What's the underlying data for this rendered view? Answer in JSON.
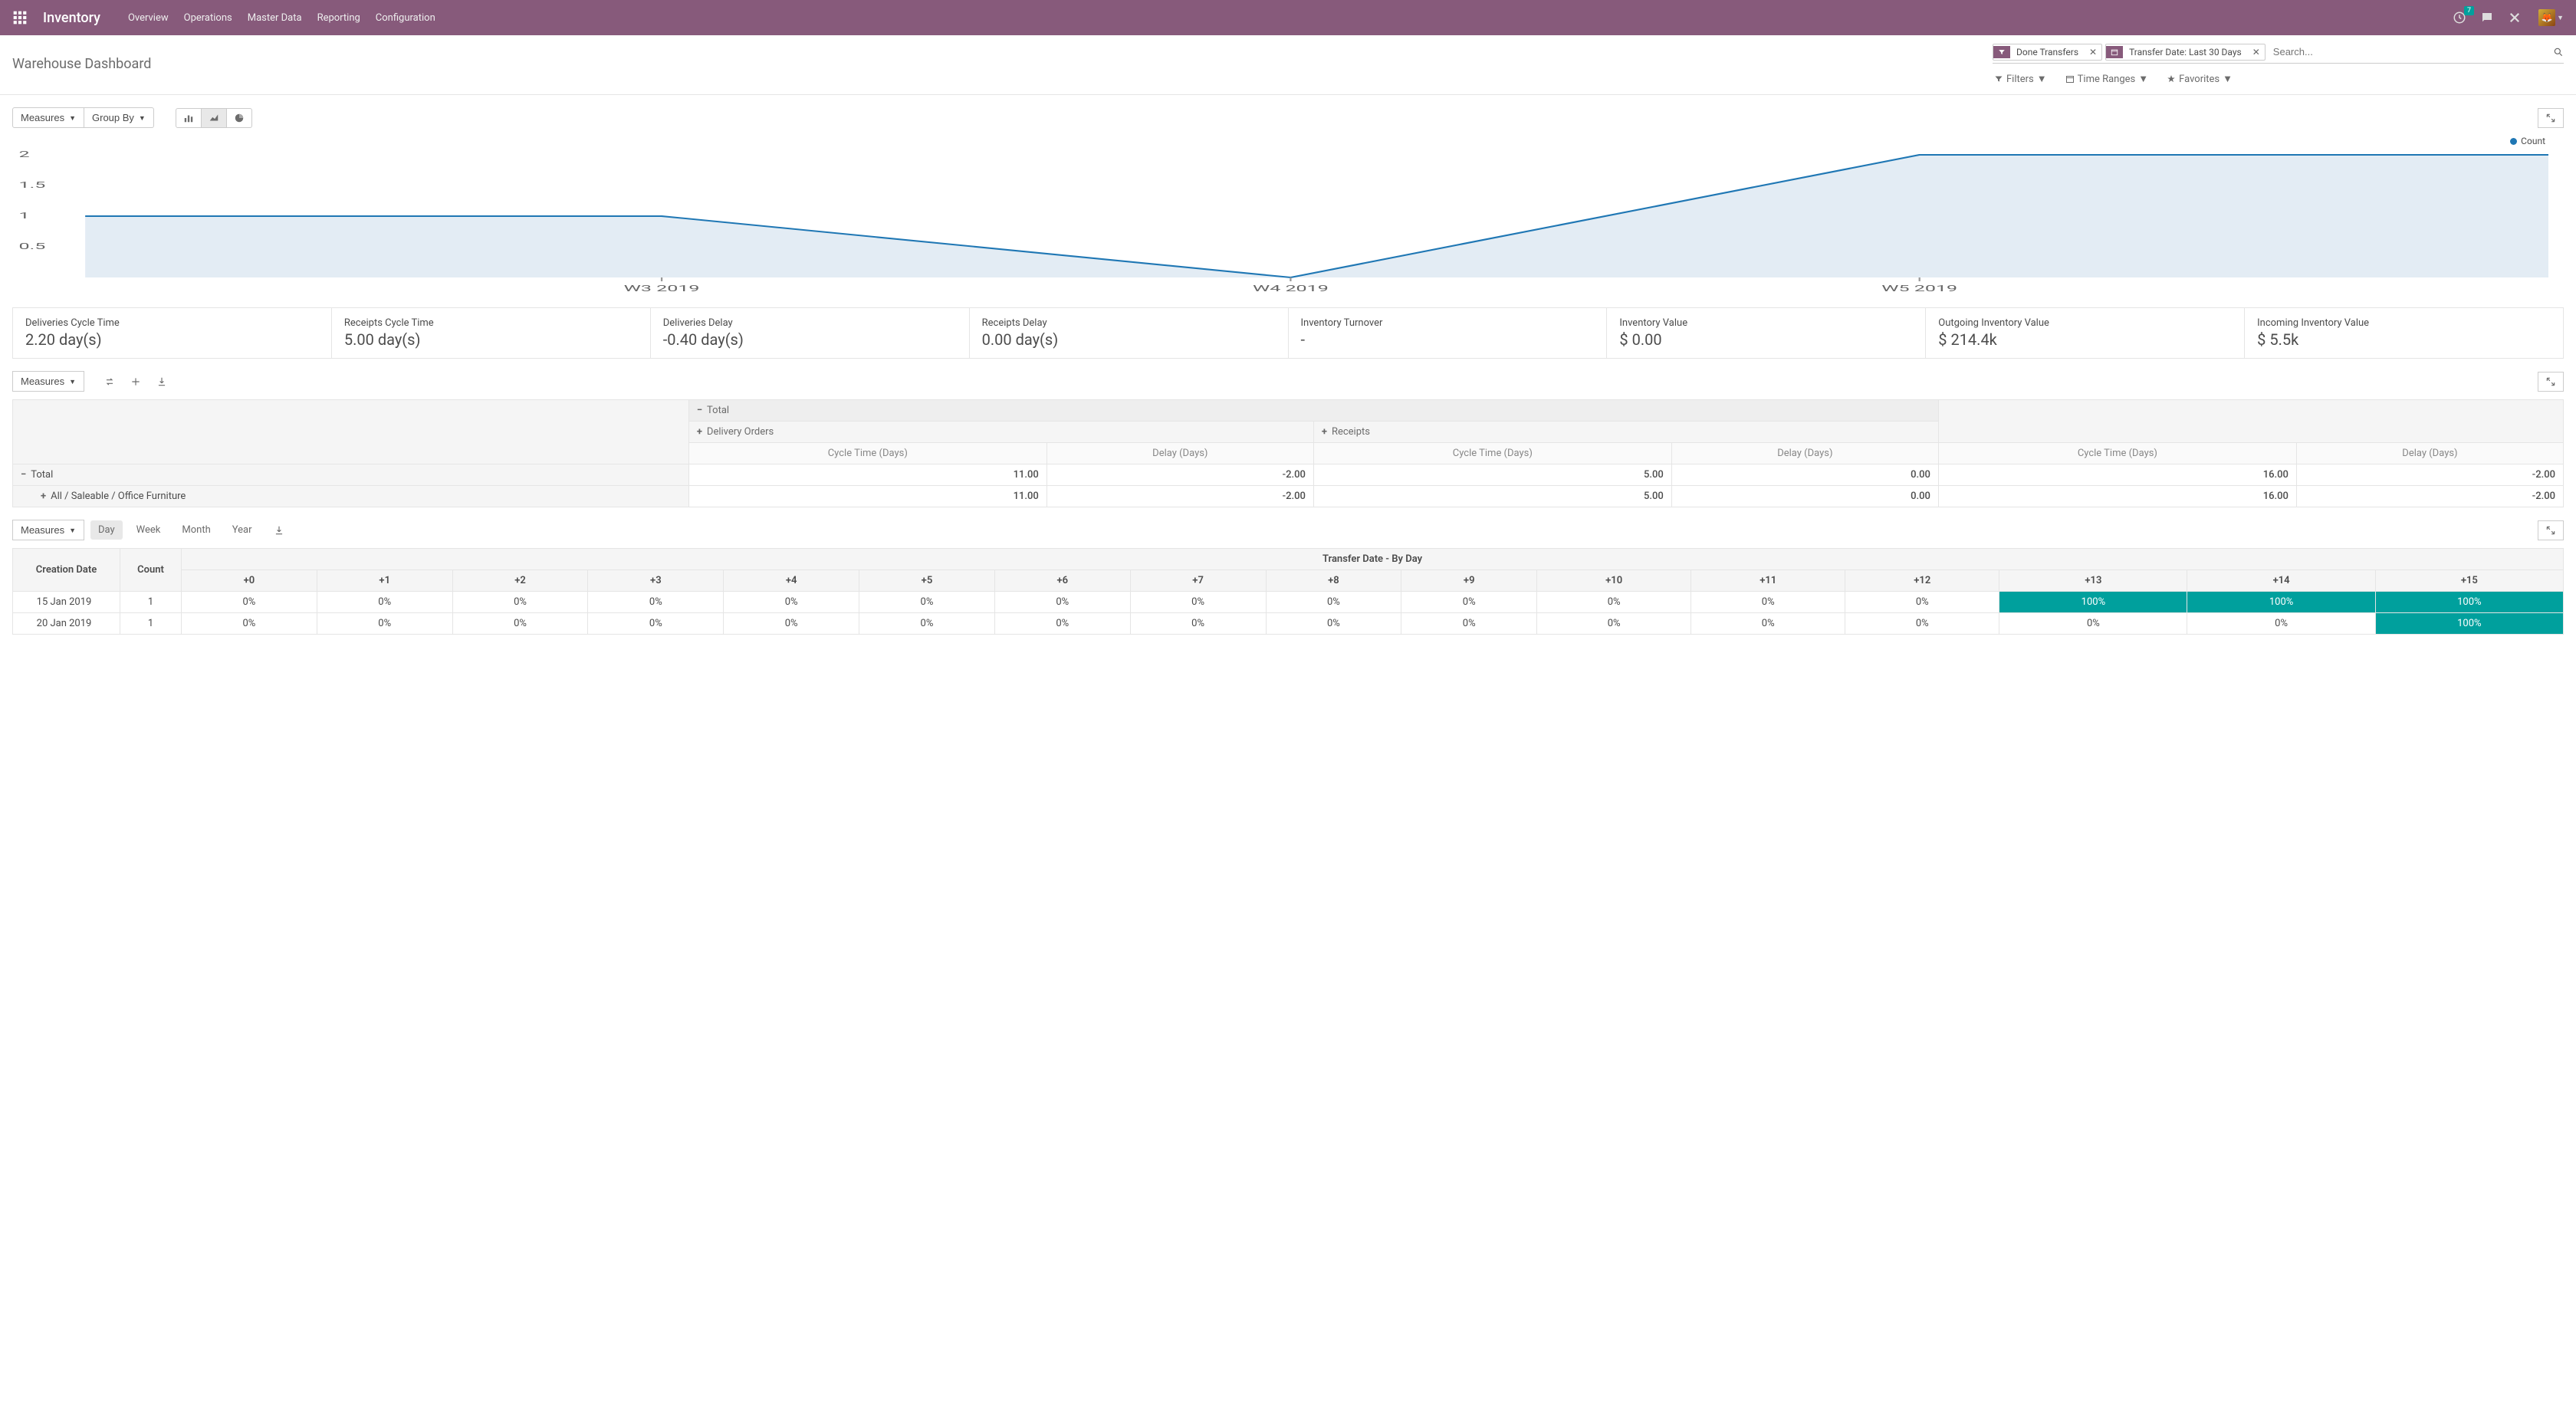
{
  "nav": {
    "app": "Inventory",
    "menu": [
      "Overview",
      "Operations",
      "Master Data",
      "Reporting",
      "Configuration"
    ],
    "notif_count": "7"
  },
  "header": {
    "title": "Warehouse Dashboard",
    "facets": [
      {
        "icon": "filter",
        "label": "Done Transfers"
      },
      {
        "icon": "calendar",
        "label": "Transfer Date: Last 30 Days"
      }
    ],
    "search_placeholder": "Search...",
    "tools": {
      "filters": "Filters",
      "time_ranges": "Time Ranges",
      "favorites": "Favorites"
    }
  },
  "chart_toolbar": {
    "measures": "Measures",
    "groupby": "Group By"
  },
  "chart_data": {
    "type": "area",
    "series": [
      {
        "name": "Count",
        "values": [
          1,
          0,
          2
        ]
      }
    ],
    "categories": [
      "W3 2019",
      "W4 2019",
      "W5 2019"
    ],
    "ylim": [
      0,
      2
    ],
    "yticks": [
      0.5,
      1.0,
      1.5,
      2.0
    ]
  },
  "kpis": [
    {
      "label": "Deliveries Cycle Time",
      "value": "2.20 day(s)"
    },
    {
      "label": "Receipts Cycle Time",
      "value": "5.00 day(s)"
    },
    {
      "label": "Deliveries Delay",
      "value": "-0.40 day(s)"
    },
    {
      "label": "Receipts Delay",
      "value": "0.00 day(s)"
    },
    {
      "label": "Inventory Turnover",
      "value": "-"
    },
    {
      "label": "Inventory Value",
      "value": "$ 0.00"
    },
    {
      "label": "Outgoing Inventory Value",
      "value": "$ 214.4k"
    },
    {
      "label": "Incoming Inventory Value",
      "value": "$ 5.5k"
    }
  ],
  "pivot": {
    "measures": "Measures",
    "top": "Total",
    "op1": "Delivery Orders",
    "op2": "Receipts",
    "m_cycle": "Cycle Time (Days)",
    "m_delay": "Delay (Days)",
    "row_total": "Total",
    "row_cat": "All / Saleable / Office Furniture",
    "rows": [
      {
        "name": "Total",
        "c1": "11.00",
        "d1": "-2.00",
        "c2": "5.00",
        "d2": "0.00",
        "ct": "16.00",
        "dt": "-2.00"
      },
      {
        "name": "All / Saleable / Office Furniture",
        "c1": "11.00",
        "d1": "-2.00",
        "c2": "5.00",
        "d2": "0.00",
        "ct": "16.00",
        "dt": "-2.00"
      }
    ]
  },
  "cohort": {
    "measures": "Measures",
    "periods": [
      "Day",
      "Week",
      "Month",
      "Year"
    ],
    "active_period": "Day",
    "col_creation": "Creation Date",
    "col_count": "Count",
    "col_group": "Transfer Date - By Day",
    "offsets": [
      "+0",
      "+1",
      "+2",
      "+3",
      "+4",
      "+5",
      "+6",
      "+7",
      "+8",
      "+9",
      "+10",
      "+11",
      "+12",
      "+13",
      "+14",
      "+15"
    ],
    "rows": [
      {
        "date": "15 Jan 2019",
        "count": "1",
        "cells": [
          "0%",
          "0%",
          "0%",
          "0%",
          "0%",
          "0%",
          "0%",
          "0%",
          "0%",
          "0%",
          "0%",
          "0%",
          "0%",
          "100%",
          "100%",
          "100%"
        ]
      },
      {
        "date": "20 Jan 2019",
        "count": "1",
        "cells": [
          "0%",
          "0%",
          "0%",
          "0%",
          "0%",
          "0%",
          "0%",
          "0%",
          "0%",
          "0%",
          "0%",
          "0%",
          "0%",
          "0%",
          "0%",
          "100%"
        ]
      }
    ]
  }
}
